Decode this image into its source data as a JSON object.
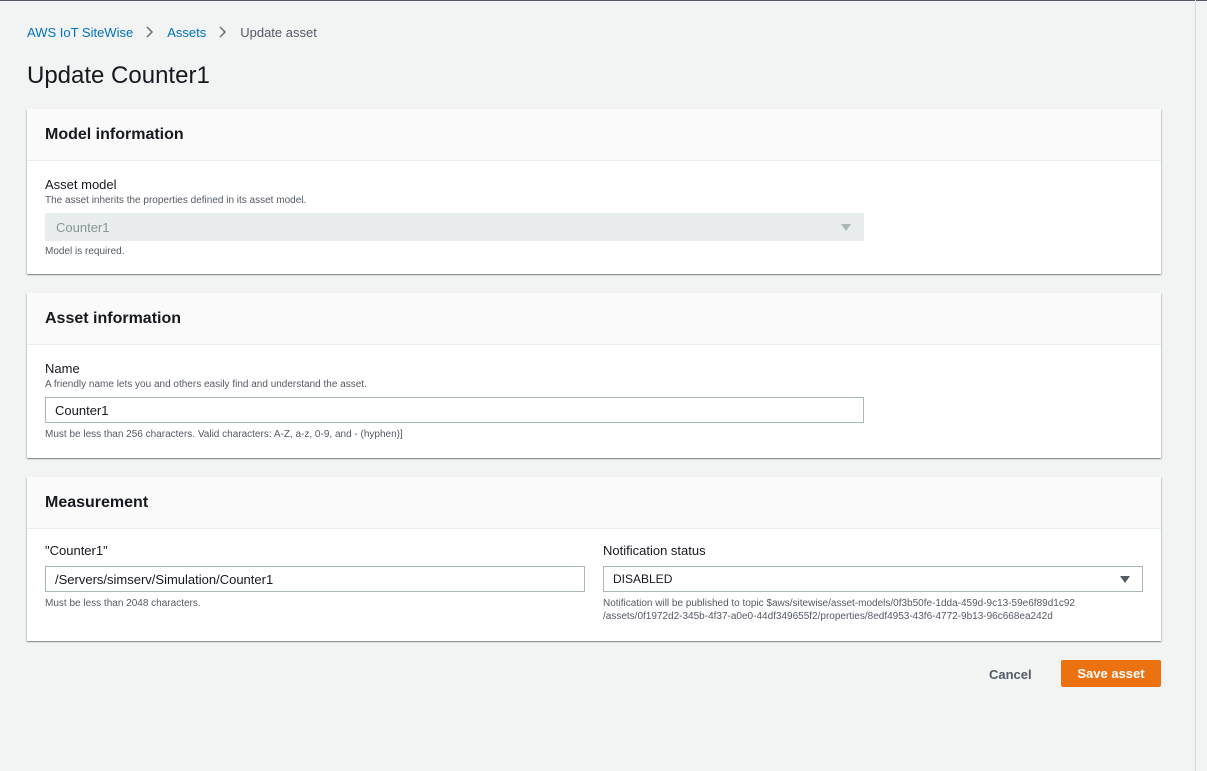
{
  "breadcrumb": {
    "root": "AWS IoT SiteWise",
    "assets": "Assets",
    "current": "Update asset"
  },
  "page": {
    "title": "Update Counter1"
  },
  "model_panel": {
    "heading": "Model information",
    "asset_model_label": "Asset model",
    "asset_model_desc": "The asset inherits the properties defined in its asset model.",
    "asset_model_value": "Counter1",
    "asset_model_hint": "Model is required."
  },
  "asset_panel": {
    "heading": "Asset information",
    "name_label": "Name",
    "name_desc": "A friendly name lets you and others easily find and understand the asset.",
    "name_value": "Counter1",
    "name_hint": "Must be less than 256 characters. Valid characters: A-Z, a-z, 0-9, and - (hyphen)]"
  },
  "measurement_panel": {
    "heading": "Measurement",
    "alias_label": "\"Counter1\"",
    "alias_value": "/Servers/simserv/Simulation/Counter1",
    "alias_hint": "Must be less than 2048 characters.",
    "notification_label": "Notification status",
    "notification_value": "DISABLED",
    "notification_hint_line1": "Notification will be published to topic $aws/sitewise/asset-models/0f3b50fe-1dda-459d-9c13-59e6f89d1c92",
    "notification_hint_line2": "/assets/0f1972d2-345b-4f37-a0e0-44df349655f2/properties/8edf4953-43f6-4772-9b13-96c668ea242d"
  },
  "actions": {
    "cancel_label": "Cancel",
    "save_label": "Save asset"
  },
  "colors": {
    "link": "#0073bb",
    "primary_button": "#ec7211",
    "background": "#f2f3f3"
  },
  "icons": {
    "breadcrumb_separator": "chevron-right-icon",
    "select_caret": "caret-down-icon"
  }
}
